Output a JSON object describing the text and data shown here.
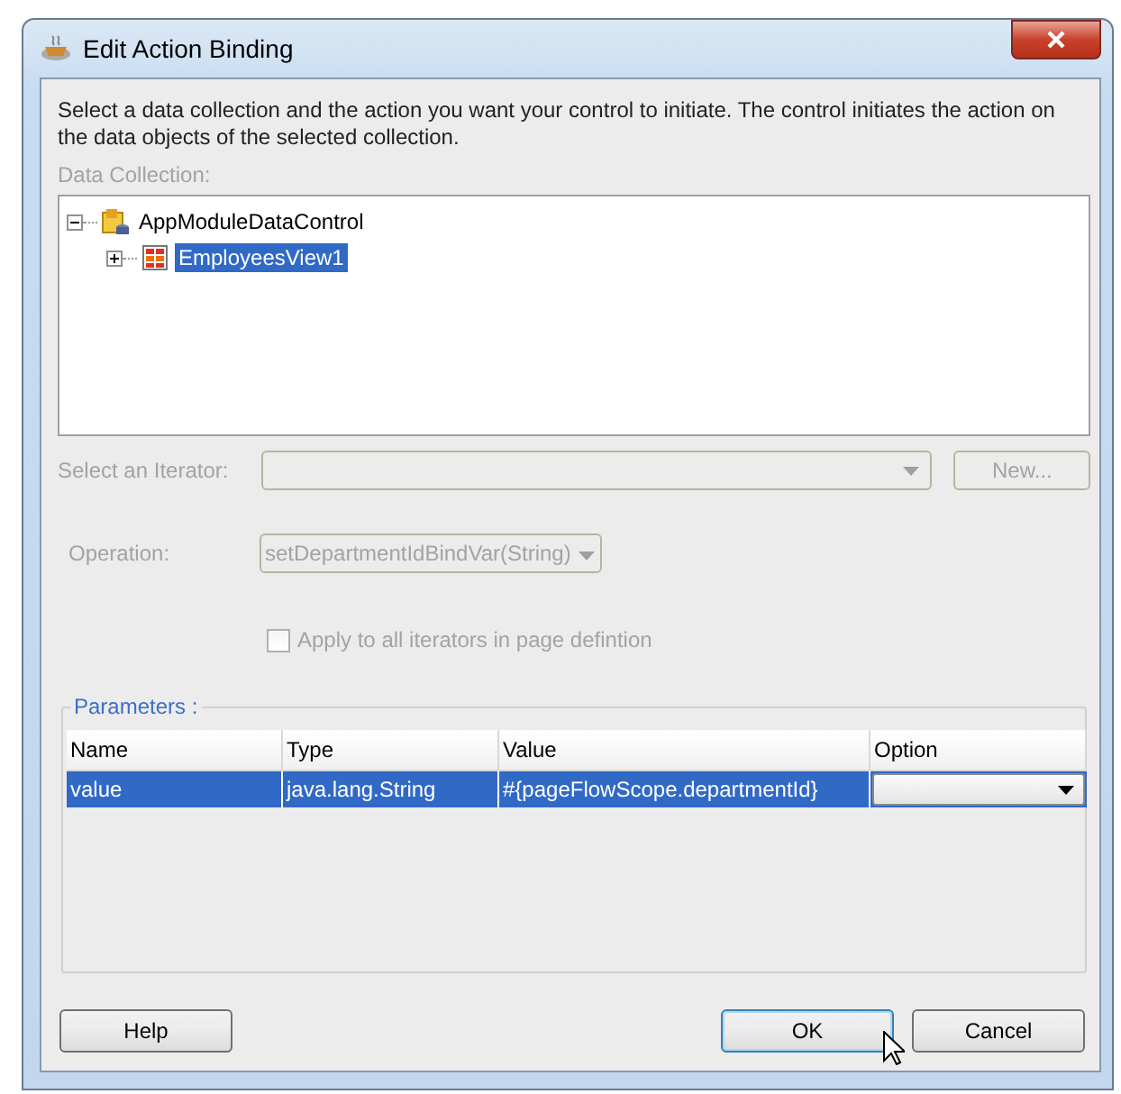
{
  "window": {
    "title": "Edit Action Binding"
  },
  "description": "Select a data collection and the action you want your control to initiate. The control initiates the action on the data objects of the selected collection.",
  "data_collection": {
    "label": "Data Collection:",
    "disabled": true,
    "tree": [
      {
        "label": "AppModuleDataControl",
        "kind": "module",
        "expanded": true,
        "selected": false,
        "children": [
          {
            "label": "EmployeesView1",
            "kind": "collection",
            "expanded": false,
            "selected": true
          }
        ]
      }
    ]
  },
  "iterator": {
    "label": "Select an Iterator:",
    "disabled": true,
    "new_button": "New..."
  },
  "operation": {
    "label": "Operation:",
    "value": "setDepartmentIdBindVar(String)",
    "disabled": true
  },
  "apply_all": {
    "label": "Apply to all iterators in page defintion",
    "checked": false,
    "disabled": true
  },
  "parameters": {
    "title": "Parameters :",
    "columns": [
      "Name",
      "Type",
      "Value",
      "Option"
    ],
    "rows": [
      {
        "name": "value",
        "type": "java.lang.String",
        "value": "#{pageFlowScope.departmentId}",
        "selected": true
      }
    ]
  },
  "buttons": [
    {
      "label": "Help",
      "kind": "help",
      "default": false
    },
    {
      "label": "OK",
      "kind": "ok",
      "default": true
    },
    {
      "label": "Cancel",
      "kind": "cancel",
      "default": false
    }
  ]
}
